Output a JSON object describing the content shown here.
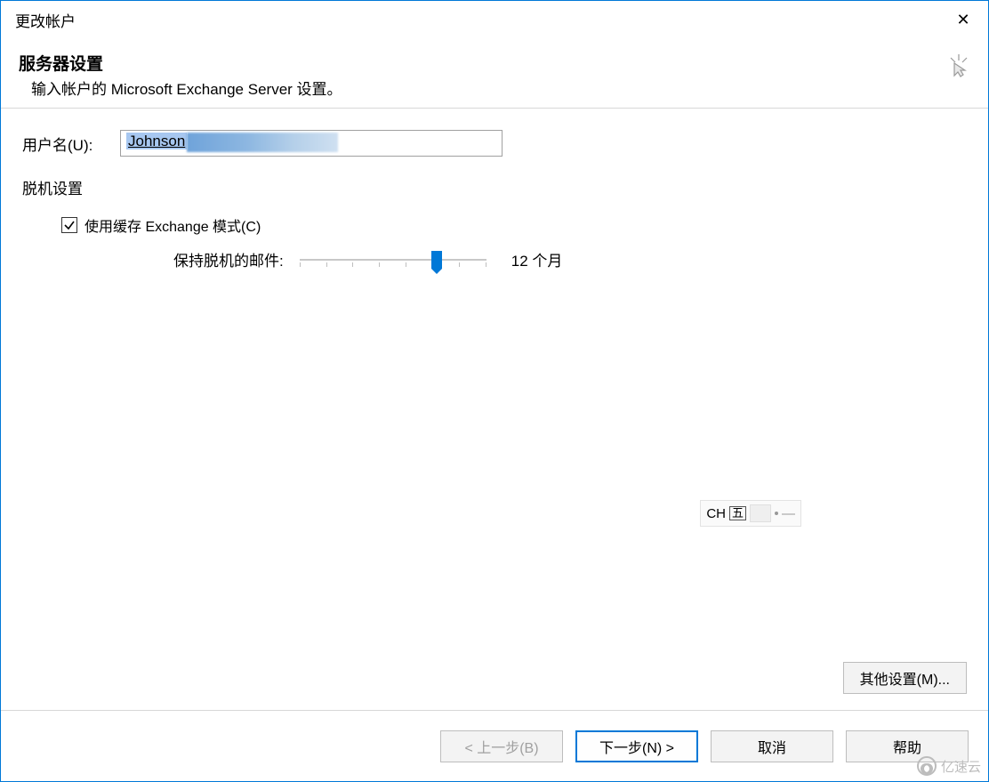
{
  "window": {
    "title": "更改帐户"
  },
  "header": {
    "title": "服务器设置",
    "subtitle": "输入帐户的 Microsoft Exchange Server 设置。"
  },
  "form": {
    "username_label": "用户名(U):",
    "username_value": "Johnson",
    "offline_section_title": "脱机设置",
    "cache_checkbox_label": "使用缓存 Exchange 模式(C)",
    "cache_checkbox_checked": true,
    "slider_label": "保持脱机的邮件:",
    "slider_value_display": "12 个月"
  },
  "ime": {
    "lang": "CH",
    "mode": "五"
  },
  "buttons": {
    "more_settings": "其他设置(M)...",
    "back": "< 上一步(B)",
    "next": "下一步(N) >",
    "cancel": "取消",
    "help": "帮助"
  },
  "watermark": {
    "text": "亿速云"
  }
}
